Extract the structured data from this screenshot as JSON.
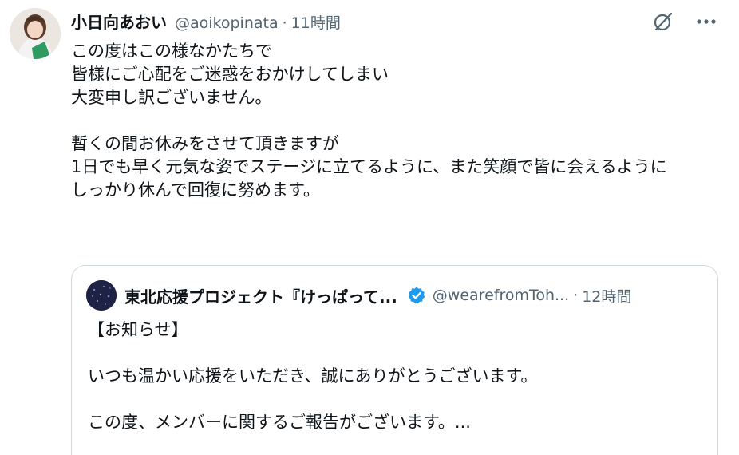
{
  "tweet": {
    "display_name": "小日向あおい",
    "handle": "@aoikopinata",
    "separator": "·",
    "time": "11時間",
    "lines": [
      "この度はこの様なかたちで",
      "皆様にご心配をご迷惑をおかけしてしまい",
      "大変申し訳ございません。",
      "",
      "暫くの間お休みをさせて頂きますが",
      "1日でも早く元気な姿でステージに立てるように、また笑顔で皆に会えるように",
      "しっかり休んで回復に努めます。"
    ]
  },
  "quote": {
    "display_name": "東北応援プロジェクト『けっぱって...",
    "handle": "@wearefromToh...",
    "separator": "·",
    "time": "12時間",
    "lines": [
      "【お知らせ】",
      "",
      "いつも温かい応援をいただき、誠にありがとうございます。",
      "",
      "この度、メンバーに関するご報告がございます。..."
    ]
  },
  "icons": {
    "grok": "grok-icon",
    "more": "more-icon",
    "verified": "verified-badge-icon"
  },
  "colors": {
    "text": "#0f1419",
    "secondary": "#536471",
    "border": "#cfd9de",
    "verified": "#1d9bf0"
  }
}
